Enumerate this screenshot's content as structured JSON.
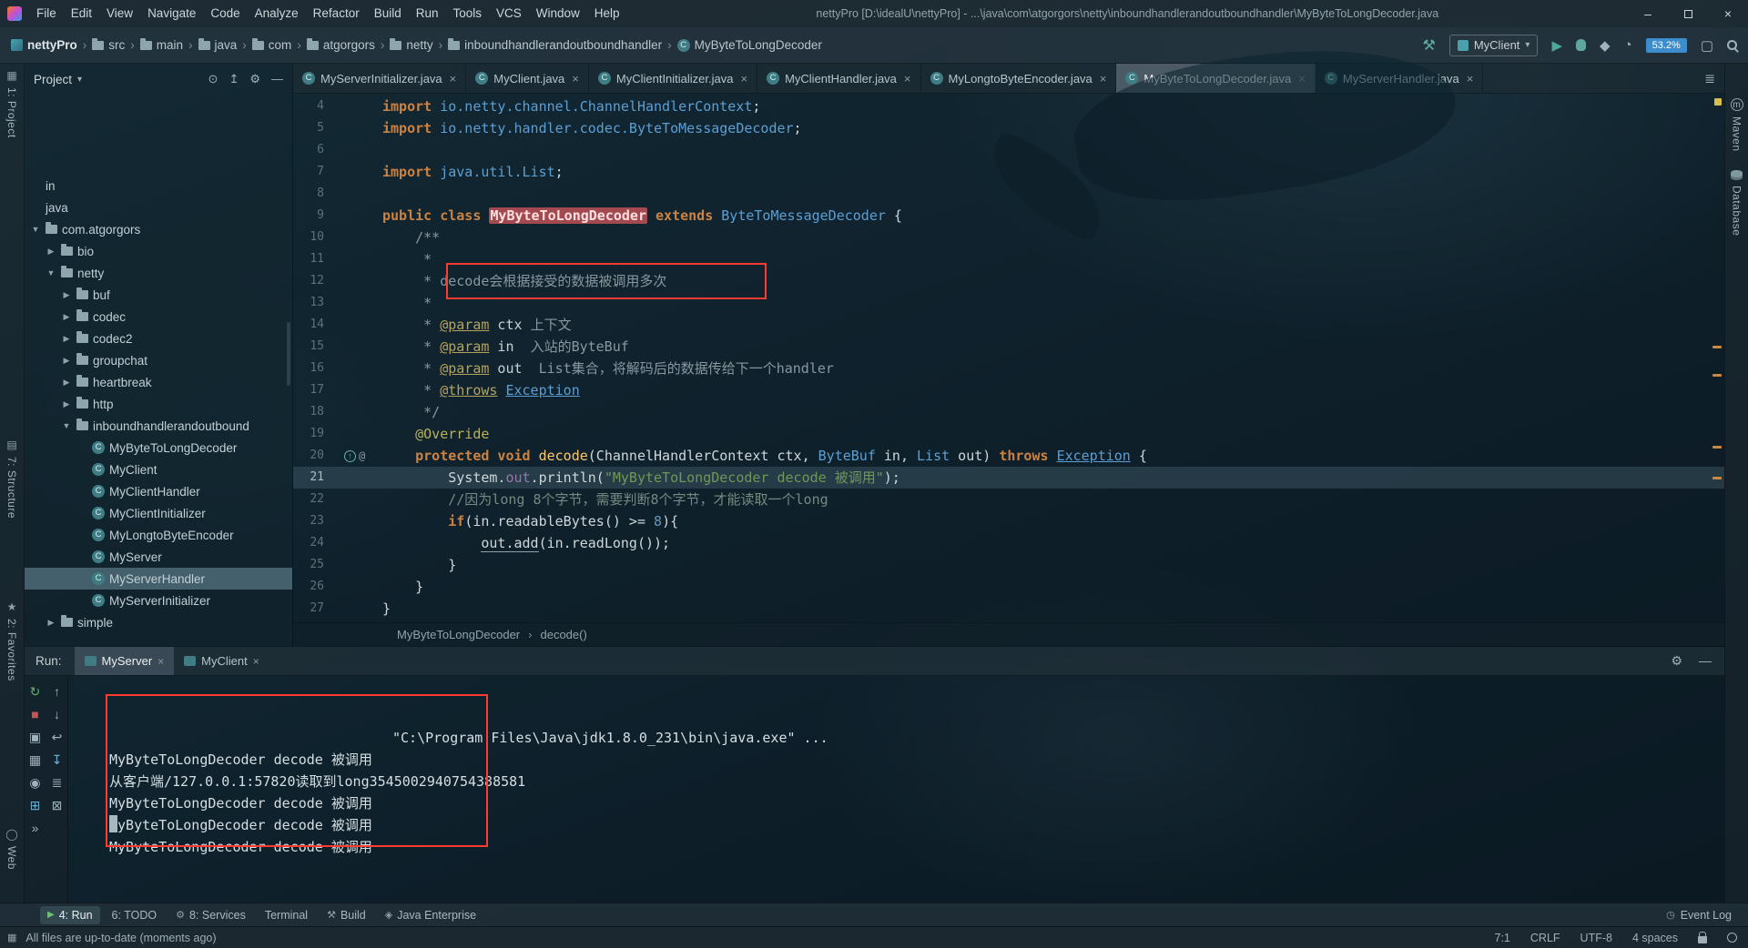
{
  "titlebar": {
    "menus": [
      "File",
      "Edit",
      "View",
      "Navigate",
      "Code",
      "Analyze",
      "Refactor",
      "Build",
      "Run",
      "Tools",
      "VCS",
      "Window",
      "Help"
    ],
    "title": "nettyPro [D:\\idealU\\nettyPro] - ...\\java\\com\\atgorgors\\netty\\inboundhandlerandoutboundhandler\\MyByteToLongDecoder.java"
  },
  "navbar": {
    "crumbs": [
      {
        "label": "nettyPro",
        "icon": "project",
        "bold": true
      },
      {
        "label": "src",
        "icon": "folder"
      },
      {
        "label": "main",
        "icon": "folder"
      },
      {
        "label": "java",
        "icon": "folder"
      },
      {
        "label": "com",
        "icon": "folder"
      },
      {
        "label": "atgorgors",
        "icon": "folder"
      },
      {
        "label": "netty",
        "icon": "folder"
      },
      {
        "label": "inboundhandlerandoutboundhandler",
        "icon": "folder"
      },
      {
        "label": "MyByteToLongDecoder",
        "icon": "class"
      }
    ],
    "run_config": "MyClient",
    "memory": "53.2%"
  },
  "left_strip": {
    "project": "1: Project",
    "structure": "7: Structure",
    "favorites": "2: Favorites",
    "web": "Web"
  },
  "right_strip": {
    "maven": "Maven",
    "database": "Database"
  },
  "project": {
    "header": "Project",
    "tree": [
      {
        "label": "in",
        "indent": 0
      },
      {
        "label": "java",
        "indent": 0
      },
      {
        "label": "com.atgorgors",
        "indent": 0,
        "arrow": "open",
        "icon": "folder"
      },
      {
        "label": "bio",
        "indent": 1,
        "arrow": "closed",
        "icon": "folder"
      },
      {
        "label": "netty",
        "indent": 1,
        "arrow": "open",
        "icon": "folder"
      },
      {
        "label": "buf",
        "indent": 2,
        "arrow": "closed",
        "icon": "folder"
      },
      {
        "label": "codec",
        "indent": 2,
        "arrow": "closed",
        "icon": "folder"
      },
      {
        "label": "codec2",
        "indent": 2,
        "arrow": "closed",
        "icon": "folder"
      },
      {
        "label": "groupchat",
        "indent": 2,
        "arrow": "closed",
        "icon": "folder"
      },
      {
        "label": "heartbreak",
        "indent": 2,
        "arrow": "closed",
        "icon": "folder"
      },
      {
        "label": "http",
        "indent": 2,
        "arrow": "closed",
        "icon": "folder"
      },
      {
        "label": "inboundhandlerandoutbound",
        "indent": 2,
        "arrow": "open",
        "icon": "folder"
      },
      {
        "label": "MyByteToLongDecoder",
        "indent": 3,
        "icon": "class"
      },
      {
        "label": "MyClient",
        "indent": 3,
        "icon": "class"
      },
      {
        "label": "MyClientHandler",
        "indent": 3,
        "icon": "class"
      },
      {
        "label": "MyClientInitializer",
        "indent": 3,
        "icon": "class"
      },
      {
        "label": "MyLongtoByteEncoder",
        "indent": 3,
        "icon": "class"
      },
      {
        "label": "MyServer",
        "indent": 3,
        "icon": "class"
      },
      {
        "label": "MyServerHandler",
        "indent": 3,
        "icon": "class",
        "selected": true
      },
      {
        "label": "MyServerInitializer",
        "indent": 3,
        "icon": "class"
      },
      {
        "label": "simple",
        "indent": 1,
        "arrow": "closed",
        "icon": "folder"
      }
    ]
  },
  "editor": {
    "tabs": [
      {
        "label": "MyServerInitializer.java"
      },
      {
        "label": "MyClient.java"
      },
      {
        "label": "MyClientInitializer.java"
      },
      {
        "label": "MyClientHandler.java"
      },
      {
        "label": "MyLongtoByteEncoder.java"
      },
      {
        "label": "MyByteToLongDecoder.java",
        "active": true
      },
      {
        "label": "MyServerHandler.java"
      }
    ],
    "breadcrumb": [
      "MyByteToLongDecoder",
      "decode()"
    ],
    "lines": [
      {
        "n": 4,
        "s": [
          {
            "t": "import ",
            "c": "kw"
          },
          {
            "t": "io.netty.channel.ChannelHandlerContext",
            "c": "type"
          },
          {
            "t": ";",
            "c": "pl"
          }
        ]
      },
      {
        "n": 5,
        "s": [
          {
            "t": "import ",
            "c": "kw"
          },
          {
            "t": "io.netty.handler.codec.ByteToMessageDecoder",
            "c": "type"
          },
          {
            "t": ";",
            "c": "pl"
          }
        ]
      },
      {
        "n": 6,
        "s": []
      },
      {
        "n": 7,
        "s": [
          {
            "t": "import ",
            "c": "kw"
          },
          {
            "t": "java.util.List",
            "c": "type"
          },
          {
            "t": ";",
            "c": "pl"
          }
        ]
      },
      {
        "n": 8,
        "s": []
      },
      {
        "n": 9,
        "s": [
          {
            "t": "public class ",
            "c": "kw"
          },
          {
            "t": "MyByteToLongDecoder",
            "c": "hl"
          },
          {
            "t": " ",
            "c": "pl"
          },
          {
            "t": "extends ",
            "c": "kw"
          },
          {
            "t": "ByteToMessageDecoder",
            "c": "type"
          },
          {
            "t": " {",
            "c": "pl"
          }
        ]
      },
      {
        "n": 10,
        "s": [
          {
            "t": "    /**",
            "c": "doc"
          }
        ]
      },
      {
        "n": 11,
        "s": [
          {
            "t": "     *",
            "c": "doc"
          }
        ]
      },
      {
        "n": 12,
        "s": [
          {
            "t": "     * ",
            "c": "doc"
          },
          {
            "t": "decode会根据接受的数据被调用多次",
            "c": "doc"
          }
        ]
      },
      {
        "n": 13,
        "s": [
          {
            "t": "     *",
            "c": "doc"
          }
        ]
      },
      {
        "n": 14,
        "s": [
          {
            "t": "     * ",
            "c": "doc"
          },
          {
            "t": "@param",
            "c": "tag"
          },
          {
            "t": " ctx ",
            "c": "docv"
          },
          {
            "t": "上下文",
            "c": "doc"
          }
        ]
      },
      {
        "n": 15,
        "s": [
          {
            "t": "     * ",
            "c": "doc"
          },
          {
            "t": "@param",
            "c": "tag"
          },
          {
            "t": " in  ",
            "c": "docv"
          },
          {
            "t": "入站的ByteBuf",
            "c": "doc"
          }
        ]
      },
      {
        "n": 16,
        "s": [
          {
            "t": "     * ",
            "c": "doc"
          },
          {
            "t": "@param",
            "c": "tag"
          },
          {
            "t": " out  ",
            "c": "docv"
          },
          {
            "t": "List集合，将解码后的数据传给下一个handler",
            "c": "doc"
          }
        ]
      },
      {
        "n": 17,
        "s": [
          {
            "t": "     * ",
            "c": "doc"
          },
          {
            "t": "@throws",
            "c": "tag"
          },
          {
            "t": " ",
            "c": "doc"
          },
          {
            "t": "Exception",
            "c": "typeu"
          }
        ]
      },
      {
        "n": 18,
        "s": [
          {
            "t": "     */",
            "c": "doc"
          }
        ]
      },
      {
        "n": 19,
        "s": [
          {
            "t": "    ",
            "c": "pl"
          },
          {
            "t": "@Override",
            "c": "ann"
          }
        ]
      },
      {
        "n": 20,
        "override": true,
        "s": [
          {
            "t": "    ",
            "c": "pl"
          },
          {
            "t": "protected void ",
            "c": "kw"
          },
          {
            "t": "decode",
            "c": "mth"
          },
          {
            "t": "(ChannelHandlerContext ctx, ",
            "c": "pl"
          },
          {
            "t": "ByteBuf",
            "c": "type"
          },
          {
            "t": " in, ",
            "c": "pl"
          },
          {
            "t": "List",
            "c": "type"
          },
          {
            "t": " out) ",
            "c": "pl"
          },
          {
            "t": "throws ",
            "c": "kw"
          },
          {
            "t": "Exception",
            "c": "typeu"
          },
          {
            "t": " {",
            "c": "pl"
          }
        ]
      },
      {
        "n": 21,
        "cur": true,
        "s": [
          {
            "t": "        System.",
            "c": "pl"
          },
          {
            "t": "out",
            "c": "fld"
          },
          {
            "t": ".println(",
            "c": "pl"
          },
          {
            "t": "\"MyByteToLongDecoder decode 被调用\"",
            "c": "str"
          },
          {
            "t": ");",
            "c": "pl"
          }
        ]
      },
      {
        "n": 22,
        "s": [
          {
            "t": "        ",
            "c": "pl"
          },
          {
            "t": "//因为long 8个字节，需要判断8个字节，才能读取一个long",
            "c": "cmt"
          }
        ]
      },
      {
        "n": 23,
        "s": [
          {
            "t": "        ",
            "c": "pl"
          },
          {
            "t": "if",
            "c": "kw"
          },
          {
            "t": "(in.readableBytes() >= ",
            "c": "pl"
          },
          {
            "t": "8",
            "c": "num"
          },
          {
            "t": "){",
            "c": "pl"
          }
        ]
      },
      {
        "n": 24,
        "s": [
          {
            "t": "            ",
            "c": "pl"
          },
          {
            "t": "out.add",
            "c": "wrn"
          },
          {
            "t": "(in.readLong());",
            "c": "pl"
          }
        ]
      },
      {
        "n": 25,
        "s": [
          {
            "t": "        }",
            "c": "pl"
          }
        ]
      },
      {
        "n": 26,
        "s": [
          {
            "t": "    }",
            "c": "pl"
          }
        ]
      },
      {
        "n": 27,
        "s": [
          {
            "t": "}",
            "c": "pl"
          }
        ]
      }
    ]
  },
  "run_panel": {
    "label": "Run:",
    "tabs": [
      {
        "label": "MyServer",
        "active": true
      },
      {
        "label": "MyClient"
      }
    ],
    "toolbar": [
      "rerun",
      "up",
      "stop",
      "down",
      "snapshot",
      "softwrap",
      "memory",
      "scrollend",
      "pin",
      "print",
      "restore",
      "clear",
      "more"
    ],
    "console": {
      "command_line": "\"C:\\Program Files\\Java\\jdk1.8.0_231\\bin\\java.exe\" ...",
      "lines": [
        "MyByteToLongDecoder decode 被调用",
        "从客户端/127.0.0.1:57820读取到long3545002940754388581",
        "MyByteToLongDecoder decode 被调用",
        "MyByteToLongDecoder decode 被调用",
        "MyByteToLongDecoder decode 被调用"
      ]
    }
  },
  "bottom_bar": {
    "items": [
      {
        "label": "4: Run",
        "icon": "run",
        "active": true
      },
      {
        "label": "6: TODO"
      },
      {
        "label": "8: Services",
        "icon": "services"
      },
      {
        "label": "Terminal"
      },
      {
        "label": "Build",
        "icon": "build"
      },
      {
        "label": "Java Enterprise",
        "icon": "javaee"
      }
    ],
    "event_log": "Event Log"
  },
  "status_bar": {
    "message": "All files are up-to-date (moments ago)",
    "caret": "7:1",
    "line_sep": "CRLF",
    "encoding": "UTF-8",
    "indent": "4 spaces"
  }
}
